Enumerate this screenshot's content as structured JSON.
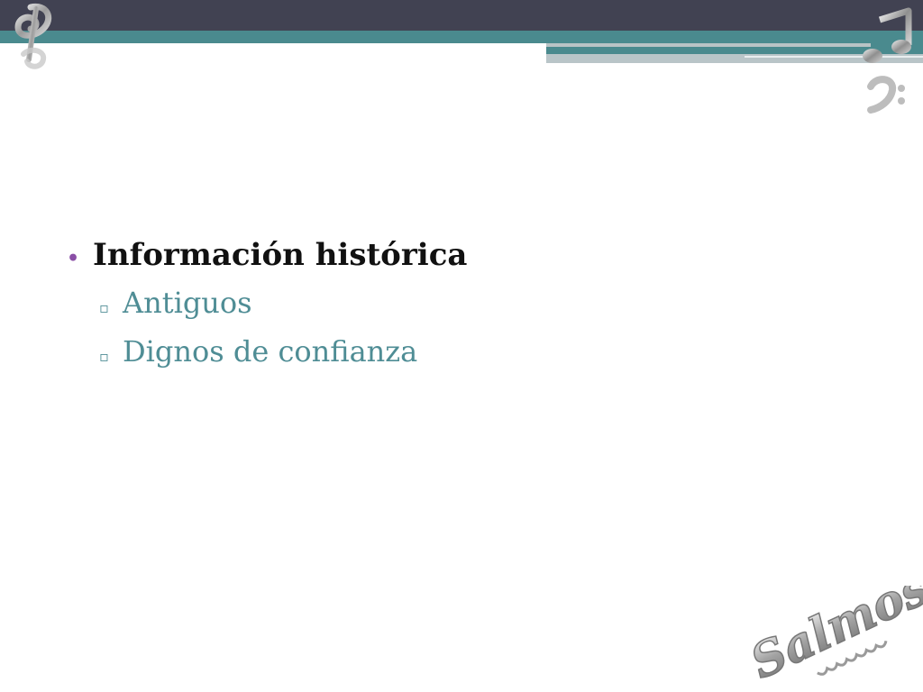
{
  "slide": {
    "bullets": [
      {
        "marker": "•",
        "text": "Información histórica",
        "children": [
          {
            "marker": "▫",
            "text": "Antiguos"
          },
          {
            "marker": "▫",
            "text": "Dignos de confianza"
          }
        ]
      }
    ]
  },
  "decor": {
    "stamp_text": "Salmos",
    "icons": [
      "treble-clef-icon",
      "music-note-icon",
      "bass-clef-icon"
    ]
  },
  "colors": {
    "header_dark": "#414252",
    "teal": "#4a8a8e",
    "bullet_purple": "#8a4fa6",
    "subtext_teal": "#4f8d95"
  }
}
